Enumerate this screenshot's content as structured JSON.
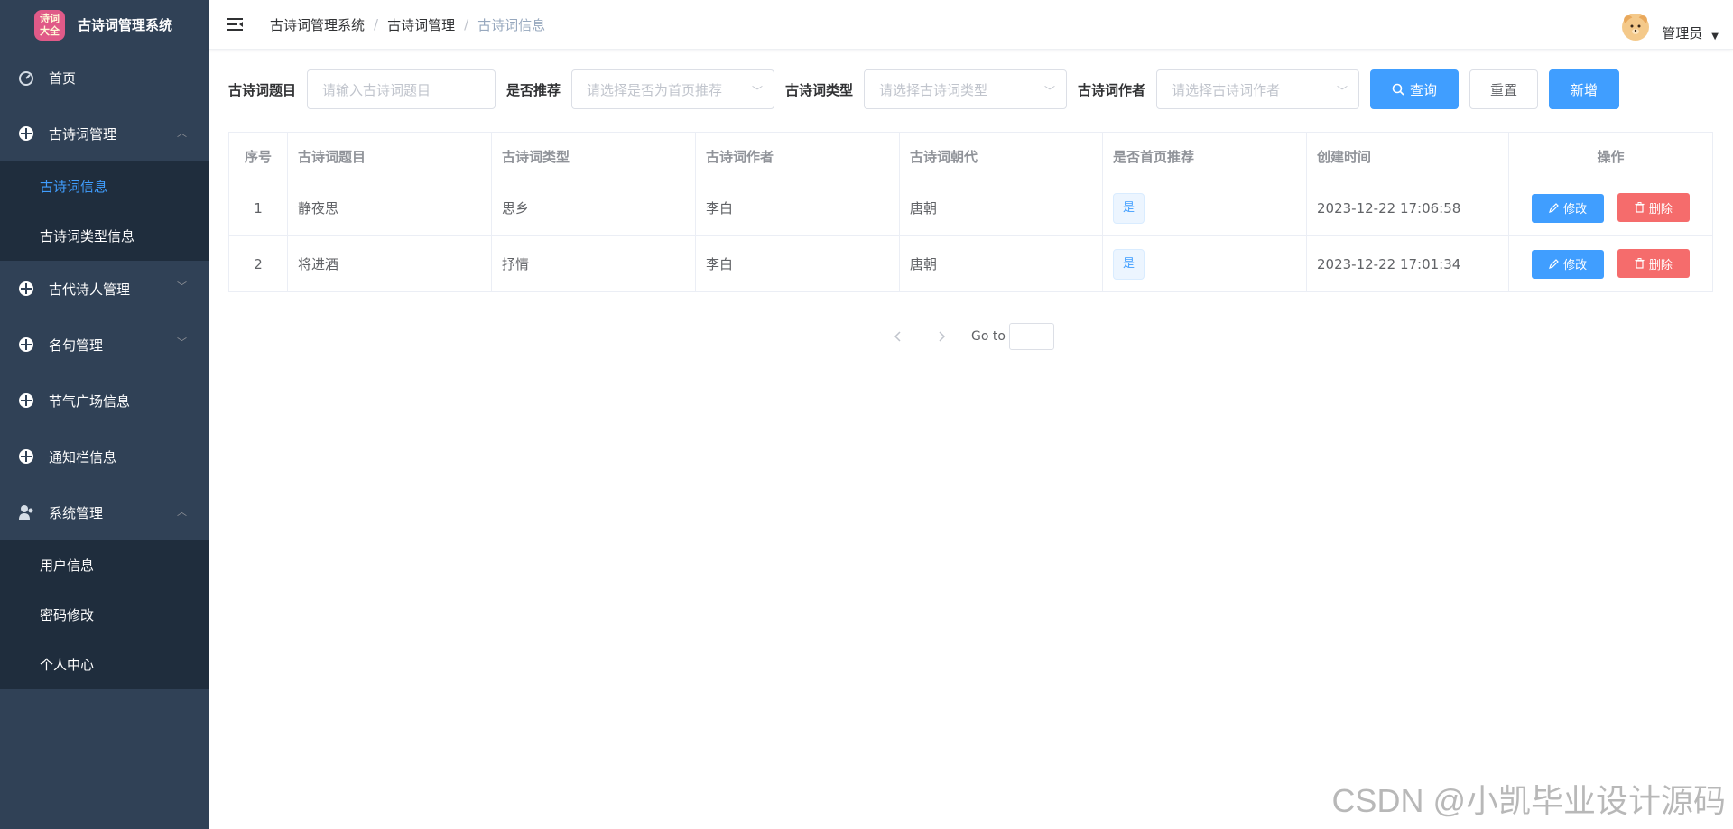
{
  "app": {
    "logo_text": "诗词大全",
    "title": "古诗词管理系统"
  },
  "sidebar": {
    "items": [
      {
        "label": "首页",
        "icon": "dashboard-icon"
      },
      {
        "label": "古诗词管理",
        "icon": "plus-circle-icon",
        "expanded": true,
        "children": [
          {
            "label": "古诗词信息",
            "active": true
          },
          {
            "label": "古诗词类型信息"
          }
        ]
      },
      {
        "label": "古代诗人管理",
        "icon": "plus-circle-icon"
      },
      {
        "label": "名句管理",
        "icon": "plus-circle-icon"
      },
      {
        "label": "节气广场信息",
        "icon": "plus-circle-icon"
      },
      {
        "label": "通知栏信息",
        "icon": "plus-circle-icon"
      },
      {
        "label": "系统管理",
        "icon": "user-group-icon",
        "expanded": true,
        "children": [
          {
            "label": "用户信息"
          },
          {
            "label": "密码修改"
          },
          {
            "label": "个人中心"
          }
        ]
      }
    ]
  },
  "header": {
    "breadcrumb": [
      "古诗词管理系统",
      "古诗词管理",
      "古诗词信息"
    ],
    "user_name": "管理员"
  },
  "search": {
    "title_label": "古诗词题目",
    "title_placeholder": "请输入古诗词题目",
    "recommend_label": "是否推荐",
    "recommend_placeholder": "请选择是否为首页推荐",
    "type_label": "古诗词类型",
    "type_placeholder": "请选择古诗词类型",
    "author_label": "古诗词作者",
    "author_placeholder": "请选择古诗词作者",
    "query_button": "查询",
    "reset_button": "重置",
    "add_button": "新增"
  },
  "table": {
    "headers": [
      "序号",
      "古诗词题目",
      "古诗词类型",
      "古诗词作者",
      "古诗词朝代",
      "是否首页推荐",
      "创建时间",
      "操作"
    ],
    "rows": [
      {
        "index": "1",
        "title": "静夜思",
        "type": "思乡",
        "author": "李白",
        "dynasty": "唐朝",
        "recommend": "是",
        "created": "2023-12-22 17:06:58"
      },
      {
        "index": "2",
        "title": "将进酒",
        "type": "抒情",
        "author": "李白",
        "dynasty": "唐朝",
        "recommend": "是",
        "created": "2023-12-22 17:01:34"
      }
    ],
    "edit_label": "修改",
    "delete_label": "删除"
  },
  "pagination": {
    "goto_label": "Go to"
  },
  "watermark": "CSDN @小凯毕业设计源码",
  "colors": {
    "sidebar_bg": "#304156",
    "submenu_bg": "#1f2d3d",
    "primary": "#409eff",
    "danger": "#f56c6c"
  }
}
